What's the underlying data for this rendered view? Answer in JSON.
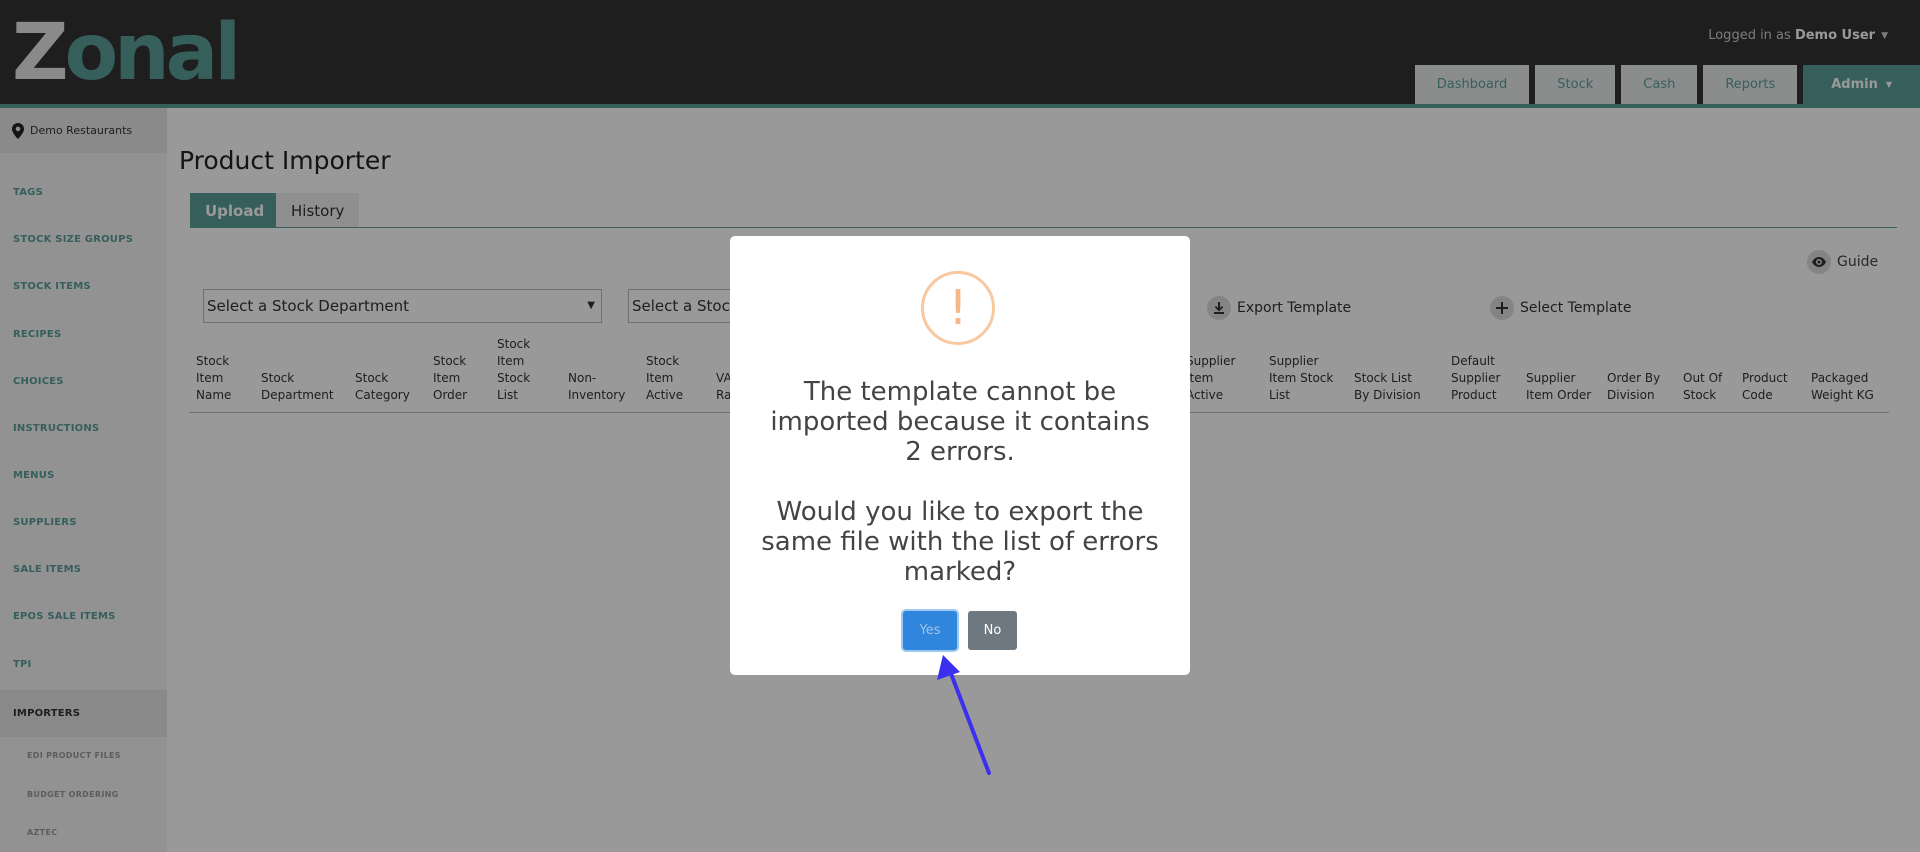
{
  "header": {
    "logo": "Zonal",
    "login_prefix": "Logged in as",
    "user": "Demo User",
    "nav": [
      "Dashboard",
      "Stock",
      "Cash",
      "Reports",
      "Admin"
    ]
  },
  "sidebar": {
    "location": "Demo Restaurants",
    "items": [
      "TAGS",
      "STOCK SIZE GROUPS",
      "STOCK ITEMS",
      "RECIPES",
      "CHOICES",
      "INSTRUCTIONS",
      "MENUS",
      "SUPPLIERS",
      "SALE ITEMS",
      "EPOS SALE ITEMS",
      "TPI",
      "IMPORTERS"
    ],
    "subitems": [
      "EDI PRODUCT FILES",
      "BUDGET ORDERING",
      "AZTEC"
    ]
  },
  "main": {
    "title": "Product Importer",
    "tabs": [
      "Upload",
      "History"
    ],
    "guide": "Guide",
    "select_department": "Select a Stock Department",
    "select_stock": "Select a Stock",
    "export_template": "Export Template",
    "select_template": "Select Template",
    "columns": [
      "Stock\nItem\nName",
      "Stock\nDepartment",
      "Stock\nCategory",
      "Stock\nItem\nOrder",
      "Stock\nItem\nStock\nList",
      "Non-\nInventory",
      "Stock\nItem\nActive",
      "VA\nRa",
      "Supplier\nItem\nActive",
      "Supplier\nItem Stock\nList",
      "Stock List\nBy Division",
      "Default\nSupplier\nProduct",
      "Supplier\nItem Order",
      "Order By\nDivision",
      "Out Of\nStock",
      "Product\nCode",
      "Packaged\nWeight KG"
    ]
  },
  "modal": {
    "message": "The template cannot be\nimported because it contains\n2 errors.\n\nWould you like to export the\nsame file with the list of errors\nmarked?",
    "yes": "Yes",
    "no": "No"
  },
  "colors": {
    "accent": "#5a9e9a",
    "header": "#333333",
    "primary_button": "#2f86dc",
    "arrow": "#3b2ff0"
  }
}
